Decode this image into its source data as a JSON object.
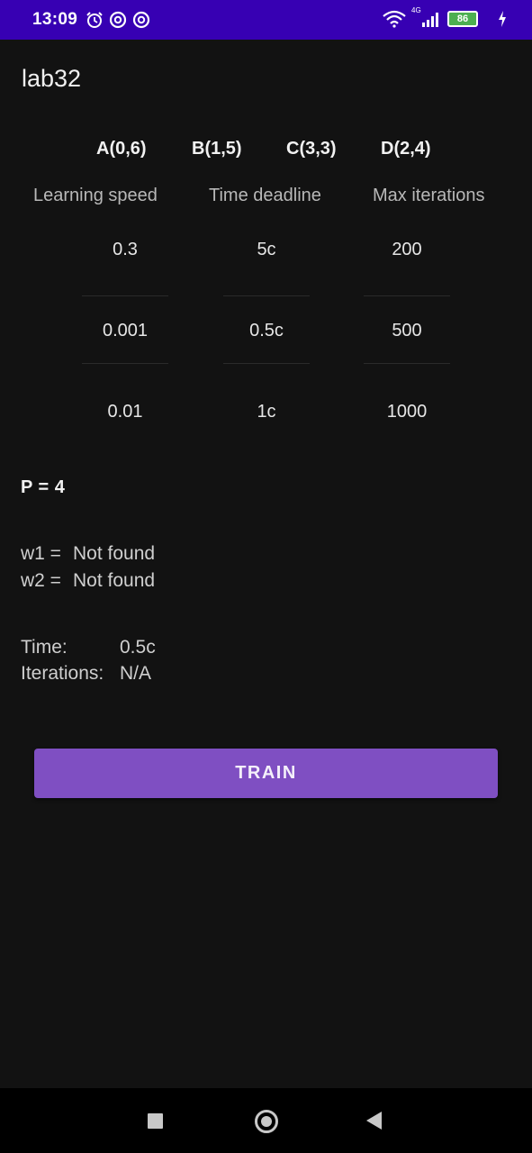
{
  "status_bar": {
    "time": "13:09",
    "network": "4G",
    "battery": "86",
    "left_icons": [
      "alarm-icon",
      "at-sign-icon",
      "at-sign-icon"
    ]
  },
  "app": {
    "title": "lab32"
  },
  "points": [
    "A(0,6)",
    "B(1,5)",
    "C(3,3)",
    "D(2,4)"
  ],
  "columns": {
    "learning_speed": {
      "header": "Learning speed",
      "values": [
        "0.3",
        "0.001",
        "0.01"
      ]
    },
    "time_deadline": {
      "header": "Time deadline",
      "values": [
        "5c",
        "0.5c",
        "1c"
      ]
    },
    "max_iterations": {
      "header": "Max iterations",
      "values": [
        "200",
        "500",
        "1000"
      ]
    }
  },
  "p_label": "P = 4",
  "weights": {
    "w1_label": "w1 =",
    "w1_value": "Not found",
    "w2_label": "w2 =",
    "w2_value": "Not found"
  },
  "results": {
    "time_label": "Time:",
    "time_value": "0.5c",
    "iterations_label": "Iterations:",
    "iterations_value": "N/A"
  },
  "train_button": "TRAIN",
  "colors": {
    "status_bar": "#3700b3",
    "button": "#7f4fc2",
    "background": "#121212"
  }
}
